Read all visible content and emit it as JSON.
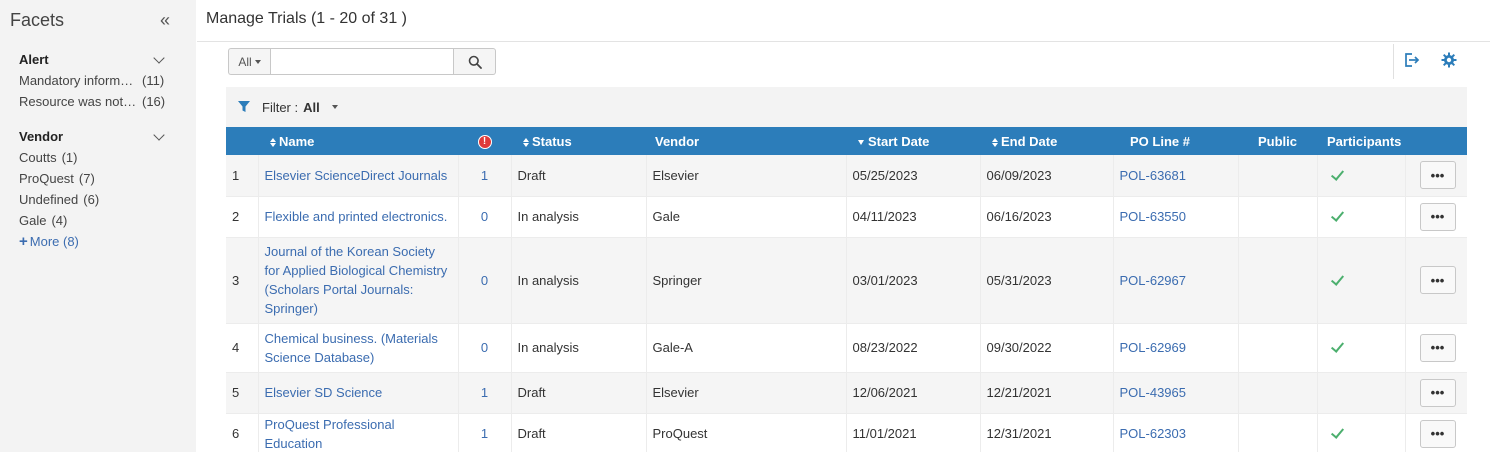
{
  "sidebar": {
    "title": "Facets",
    "collapse_glyph": "«",
    "groups": [
      {
        "title": "Alert",
        "items": [
          {
            "name": "Mandatory informa...",
            "count": "(11)"
          },
          {
            "name": "Resource was not a...",
            "count": "(16)"
          }
        ]
      },
      {
        "title": "Vendor",
        "items": [
          {
            "name": "Coutts",
            "count": "(1)"
          },
          {
            "name": "ProQuest",
            "count": "(7)"
          },
          {
            "name": "Undefined",
            "count": "(6)"
          },
          {
            "name": "Gale",
            "count": "(4)"
          }
        ],
        "more": "More (8)"
      }
    ]
  },
  "header": {
    "title": "Manage Trials (1 - 20 of 31 )"
  },
  "search": {
    "scope": "All",
    "placeholder": "",
    "value": ""
  },
  "toolbar": {
    "icons": [
      "export-icon",
      "settings-gear-icon"
    ]
  },
  "filter": {
    "label": "Filter :",
    "value": "All"
  },
  "table": {
    "columns": {
      "name": "Name",
      "status": "Status",
      "vendor": "Vendor",
      "start_date": "Start Date",
      "end_date": "End Date",
      "po_line": "PO Line #",
      "public": "Public",
      "participants": "Participants"
    },
    "rows": [
      {
        "num": "1",
        "name": "Elsevier ScienceDirect Journals",
        "alerts": "1",
        "status": "Draft",
        "vendor": "Elsevier",
        "start": "05/25/2023",
        "end": "06/09/2023",
        "po": "POL-63681",
        "public": "",
        "participants": true,
        "action": "•••"
      },
      {
        "num": "2",
        "name": "Flexible and printed electronics.",
        "alerts": "0",
        "status": "In analysis",
        "vendor": "Gale",
        "start": "04/11/2023",
        "end": "06/16/2023",
        "po": "POL-63550",
        "public": "",
        "participants": true,
        "action": "•••"
      },
      {
        "num": "3",
        "name": "Journal of the Korean Society for Applied Biological Chemistry (Scholars Portal Journals: Springer)",
        "alerts": "0",
        "status": "In analysis",
        "vendor": "Springer",
        "start": "03/01/2023",
        "end": "05/31/2023",
        "po": "POL-62967",
        "public": "",
        "participants": true,
        "action": "•••"
      },
      {
        "num": "4",
        "name": "Chemical business. (Materials Science Database)",
        "alerts": "0",
        "status": "In analysis",
        "vendor": "Gale-A",
        "start": "08/23/2022",
        "end": "09/30/2022",
        "po": "POL-62969",
        "public": "",
        "participants": true,
        "action": "•••"
      },
      {
        "num": "5",
        "name": "Elsevier SD Science",
        "alerts": "1",
        "status": "Draft",
        "vendor": "Elsevier",
        "start": "12/06/2021",
        "end": "12/21/2021",
        "po": "POL-43965",
        "public": "",
        "participants": false,
        "action": "•••"
      },
      {
        "num": "6",
        "name": "ProQuest Professional Education",
        "alerts": "1",
        "status": "Draft",
        "vendor": "ProQuest",
        "start": "11/01/2021",
        "end": "12/31/2021",
        "po": "POL-62303",
        "public": "",
        "participants": true,
        "action": "•••"
      }
    ]
  },
  "colors": {
    "header_blue": "#2c7dba",
    "link_blue": "#3b6cb0",
    "check_green": "#4caf6e",
    "alert_red": "#e03a3a"
  }
}
